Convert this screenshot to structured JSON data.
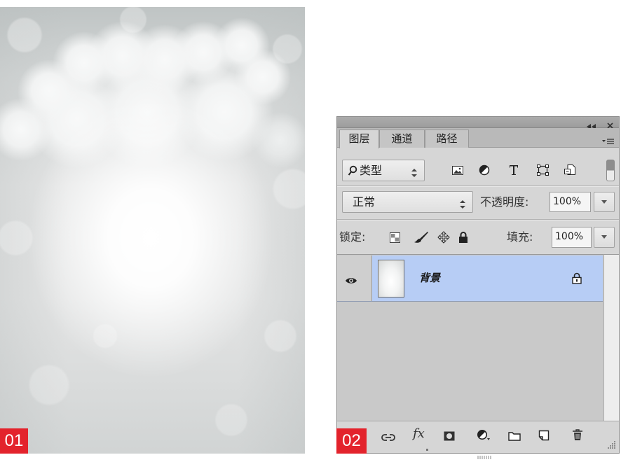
{
  "labels": {
    "image_1": "01",
    "image_2": "02"
  },
  "panel": {
    "header": {
      "collapse_icon": "double-chevron-left-icon",
      "close_icon": "close-icon"
    },
    "tabs": [
      {
        "label": "图层",
        "active": true
      },
      {
        "label": "通道",
        "active": false
      },
      {
        "label": "路径",
        "active": false
      }
    ],
    "menu_icon": "panel-menu-icon",
    "filter": {
      "search_icon": "search-icon",
      "kind": "类型",
      "icons": [
        "pixel-layer-filter-icon",
        "adjustment-layer-filter-icon",
        "type-layer-filter-icon",
        "shape-layer-filter-icon",
        "smart-object-filter-icon"
      ],
      "toggle": "filter-toggle-switch"
    },
    "blend": {
      "mode": "正常",
      "opacity_label": "不透明度:",
      "opacity": "100%"
    },
    "lock": {
      "label": "锁定:",
      "icons": [
        "lock-transparent-pixels-icon",
        "lock-image-pixels-icon",
        "lock-position-icon",
        "lock-all-icon"
      ],
      "fill_label": "填充:",
      "fill": "100%"
    },
    "layers": [
      {
        "name": "背景",
        "visible": true,
        "locked": true,
        "selected": true
      }
    ],
    "footer": {
      "fx_label": "fx",
      "icons": [
        "link-layers-icon",
        "layer-style-icon",
        "add-mask-icon",
        "new-adjustment-layer-icon",
        "new-group-icon",
        "new-layer-icon",
        "delete-layer-icon"
      ]
    }
  },
  "colors": {
    "label_red": "#e3232c",
    "selected_layer": "#b7cdf5",
    "panel_bg": "#d6d6d6"
  }
}
